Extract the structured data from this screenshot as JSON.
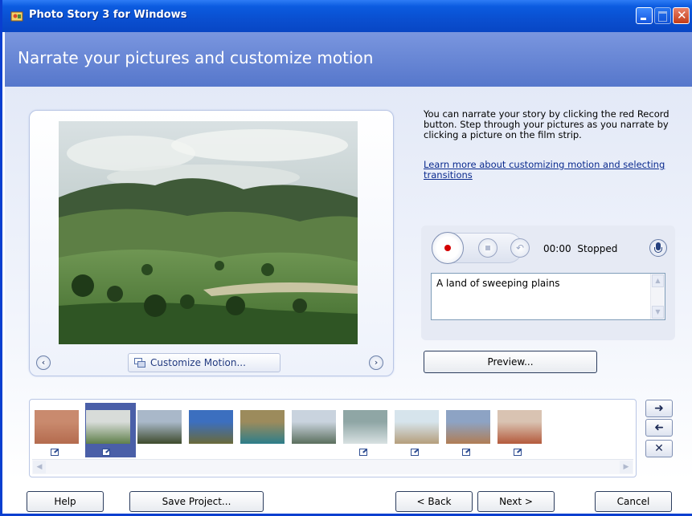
{
  "window": {
    "title": "Photo Story 3 for Windows",
    "icon": "photo-story-app-icon"
  },
  "header": {
    "title": "Narrate your pictures and customize motion"
  },
  "preview": {
    "customize_label": "Customize Motion...",
    "prev_icon": "chevron-left-icon",
    "next_icon": "chevron-right-icon"
  },
  "instructions": {
    "text": "You can narrate your story by clicking the red Record button. Step through your pictures as you narrate by clicking a picture on the film strip.",
    "link": "Learn more about customizing motion and selecting transitions"
  },
  "recorder": {
    "time": "00:00",
    "status": "Stopped",
    "narration_text": "A land of sweeping plains"
  },
  "preview_button": "Preview...",
  "filmstrip": {
    "selected_index": 1,
    "thumbnails": [
      {
        "colors": [
          "#C98A6E",
          "#B46B4E"
        ],
        "has_edit_icon": true
      },
      {
        "colors": [
          "#D8DCD9",
          "#5F7F4A"
        ],
        "has_edit_icon": true
      },
      {
        "colors": [
          "#A9B8C9",
          "#3E4B2C"
        ],
        "has_edit_icon": false
      },
      {
        "colors": [
          "#3C6FBF",
          "#6A6A3A"
        ],
        "has_edit_icon": false
      },
      {
        "colors": [
          "#9C8B5C",
          "#2D7E8A"
        ],
        "has_edit_icon": false
      },
      {
        "colors": [
          "#C9D3DE",
          "#5B6F5D"
        ],
        "has_edit_icon": false
      },
      {
        "colors": [
          "#8FA6A5",
          "#D8E1E2"
        ],
        "has_edit_icon": true
      },
      {
        "colors": [
          "#D6E4EC",
          "#B59E7C"
        ],
        "has_edit_icon": true
      },
      {
        "colors": [
          "#8DA3C4",
          "#B07D55"
        ],
        "has_edit_icon": true
      },
      {
        "colors": [
          "#D9C3B2",
          "#B45A3C"
        ],
        "has_edit_icon": true
      }
    ]
  },
  "side_buttons": {
    "right_icon": "arrow-right-icon",
    "left_icon": "arrow-left-icon",
    "delete_icon": "delete-x-icon"
  },
  "footer": {
    "help": "Help",
    "save": "Save Project...",
    "back": "< Back",
    "next": "Next >",
    "cancel": "Cancel"
  }
}
